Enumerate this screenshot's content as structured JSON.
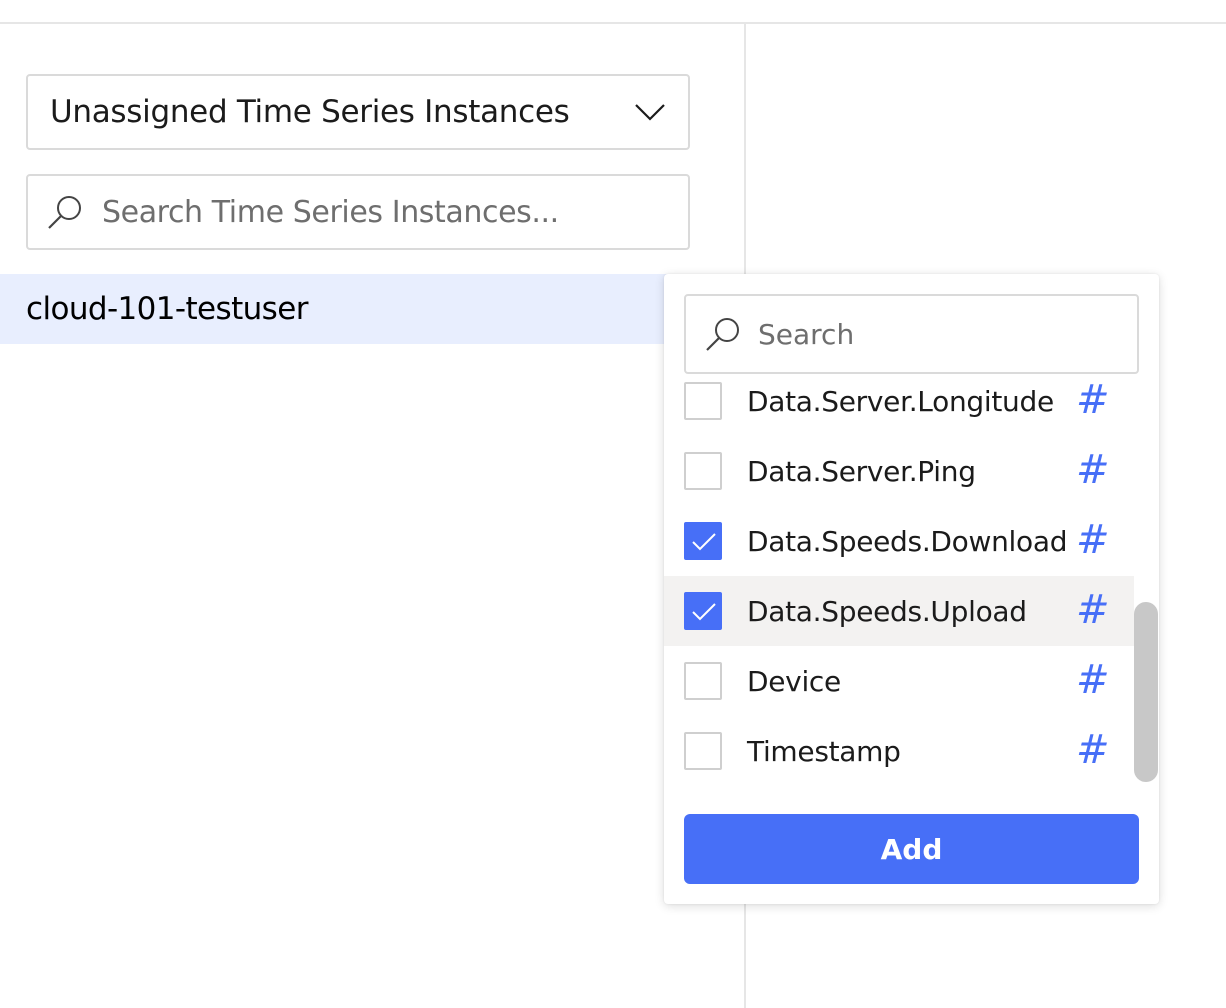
{
  "left_panel": {
    "instance_filter": {
      "selected": "Unassigned Time Series Instances",
      "icon": "chevron-down-icon"
    },
    "search": {
      "value": "",
      "placeholder": "Search Time Series Instances...",
      "icon": "search-icon"
    },
    "instances": [
      {
        "name": "cloud-101-testuser",
        "selected": true
      }
    ]
  },
  "variable_picker": {
    "search": {
      "value": "",
      "placeholder": "Search",
      "icon": "search-icon"
    },
    "items": [
      {
        "label": "Data.Server.Longitude",
        "checked": false,
        "type_icon": "#"
      },
      {
        "label": "Data.Server.Ping",
        "checked": false,
        "type_icon": "#"
      },
      {
        "label": "Data.Speeds.Download",
        "checked": true,
        "type_icon": "#"
      },
      {
        "label": "Data.Speeds.Upload",
        "checked": true,
        "type_icon": "#",
        "hovered": true
      },
      {
        "label": "Device",
        "checked": false,
        "type_icon": "#"
      },
      {
        "label": "Timestamp",
        "checked": false,
        "type_icon": "#"
      }
    ],
    "add_label": "Add"
  },
  "colors": {
    "accent": "#476ff7",
    "selected_row": "#e8eefe",
    "hover_row": "#f3f2f1",
    "border": "#dadada"
  }
}
